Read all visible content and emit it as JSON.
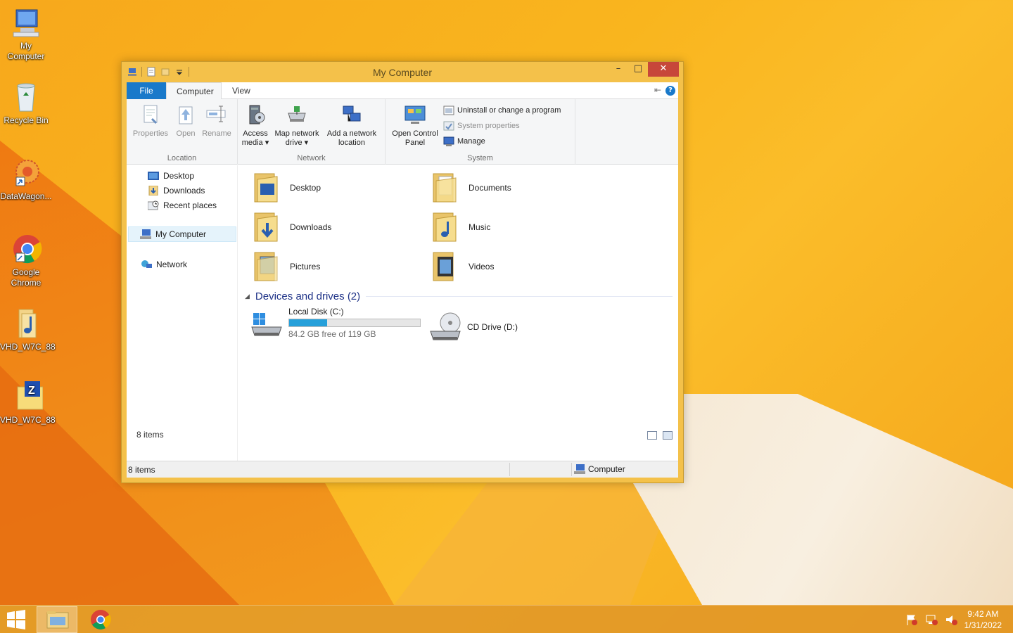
{
  "desktop": {
    "icons": [
      {
        "label": "My\nComputer"
      },
      {
        "label": "Recycle Bin"
      },
      {
        "label": "DataWagon..."
      },
      {
        "label": "Google Chrome"
      },
      {
        "label": "VHD_W7C_88"
      },
      {
        "label": "VHD_W7C_88"
      }
    ]
  },
  "window": {
    "title": "My Computer",
    "controls": {
      "minimize": "–",
      "maximize": "□",
      "close": "✕"
    },
    "tabs": {
      "file": "File",
      "computer": "Computer",
      "view": "View"
    },
    "help": "?",
    "ribbon": {
      "location": {
        "label": "Location",
        "properties": "Properties",
        "open": "Open",
        "rename": "Rename"
      },
      "network": {
        "label": "Network",
        "access_media_1": "Access",
        "access_media_2": "media ▾",
        "map_drive_1": "Map network",
        "map_drive_2": "drive ▾",
        "add_location_1": "Add a network",
        "add_location_2": "location"
      },
      "system": {
        "label": "System",
        "control_panel_1": "Open Control",
        "control_panel_2": "Panel",
        "uninstall": "Uninstall or change a program",
        "system_properties": "System properties",
        "manage": "Manage"
      }
    },
    "nav": {
      "desktop": "Desktop",
      "downloads": "Downloads",
      "recent": "Recent places",
      "my_computer": "My Computer",
      "network": "Network"
    },
    "folders": {
      "desktop": "Desktop",
      "documents": "Documents",
      "downloads": "Downloads",
      "music": "Music",
      "pictures": "Pictures",
      "videos": "Videos"
    },
    "devices_header": "Devices and drives (2)",
    "drives": {
      "c_name": "Local Disk (C:)",
      "c_free": "84.2 GB free of 119 GB",
      "c_used_fraction": 0.29,
      "d_name": "CD Drive (D:)"
    },
    "item_count": "8 items",
    "status": {
      "left": "8 items",
      "right": "Computer"
    }
  },
  "taskbar": {
    "time": "9:42 AM",
    "date": "1/31/2022"
  }
}
